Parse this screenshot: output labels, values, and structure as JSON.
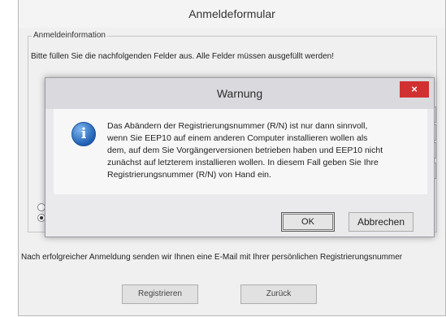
{
  "outer": {
    "title": "Anmeldeformular",
    "group_label": "Anmeldeinformation",
    "instruction": "Bitte füllen Sie die nachfolgenden Felder aus. Alle Felder müssen ausgefüllt werden!",
    "after_text": "Nach erfolgreicher Anmeldung senden wir Ihnen eine E-Mail mit Ihrer persönlichen Registrierungsnummer",
    "register_label": "Registrieren",
    "back_label": "Zurück"
  },
  "dialog": {
    "title": "Warnung",
    "close_glyph": "×",
    "message": "Das Abändern der Registrierungsnummer (R/N) ist nur dann sinnvoll,\nwenn Sie EEP10 auf einem anderen Computer installieren wollen als\ndem, auf dem Sie Vorgängerversionen betrieben haben und EEP10 nicht\nzunächst auf letzterem installieren wollen. In diesem Fall geben Sie Ihre\nRegistrierungsnummer (R/N) von Hand ein.",
    "ok_label": "OK",
    "cancel_label": "Abbrechen"
  },
  "colors": {
    "close_red": "#d13030",
    "info_blue": "#1f5fb4"
  }
}
